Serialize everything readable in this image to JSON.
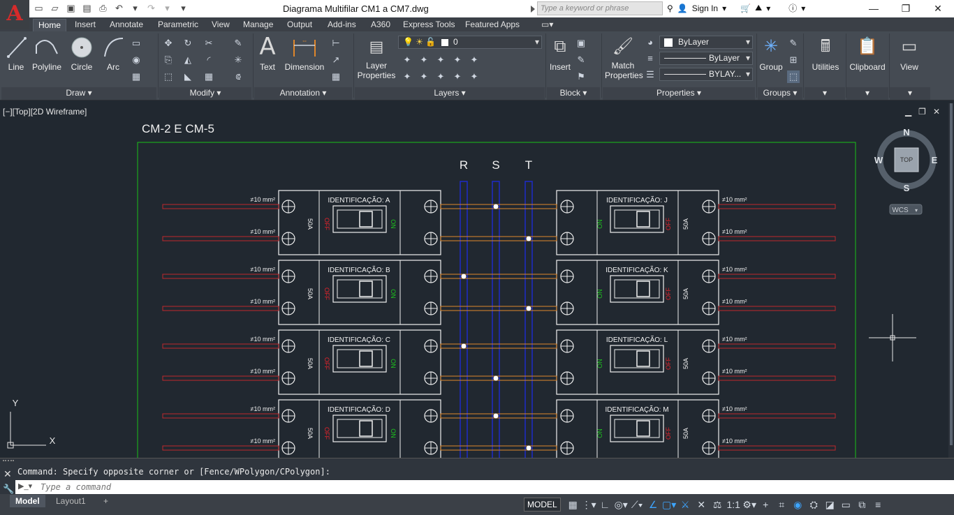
{
  "app": {
    "logo": "A",
    "title": "Diagrama Multifilar CM1 a CM7.dwg"
  },
  "search": {
    "placeholder": "Type a keyword or phrase"
  },
  "account": {
    "sign_in": "Sign In"
  },
  "tabs": [
    "Home",
    "Insert",
    "Annotate",
    "Parametric",
    "View",
    "Manage",
    "Output",
    "Add-ins",
    "A360",
    "Express Tools",
    "Featured Apps"
  ],
  "ribbon": {
    "draw": {
      "line": "Line",
      "polyline": "Polyline",
      "circle": "Circle",
      "arc": "Arc",
      "panel": "Draw ▾"
    },
    "modify": {
      "panel": "Modify ▾"
    },
    "annotation": {
      "text": "Text",
      "dimension": "Dimension",
      "panel": "Annotation ▾"
    },
    "layers": {
      "layer_properties_1": "Layer",
      "layer_properties_2": "Properties",
      "current_layer": "0",
      "panel": "Layers ▾"
    },
    "block": {
      "insert": "Insert",
      "panel": "Block ▾"
    },
    "properties": {
      "match_1": "Match",
      "match_2": "Properties",
      "color": "ByLayer",
      "linetype": "ByLayer",
      "lineweight": "BYLAY...",
      "panel": "Properties ▾"
    },
    "groups": {
      "group": "Group",
      "panel": "Groups ▾"
    },
    "utilities": "Utilities",
    "clipboard": "Clipboard",
    "view": "View"
  },
  "viewport": {
    "label": "[−][Top][2D Wireframe]",
    "compass": {
      "n": "N",
      "s": "S",
      "e": "E",
      "w": "W",
      "top": "TOP",
      "wcs": "WCS"
    },
    "ucs": {
      "x": "X",
      "y": "Y"
    }
  },
  "drawing": {
    "title": "CM-2 E CM-5",
    "phases": [
      "R",
      "S",
      "T"
    ],
    "left_ids": [
      "IDENTIFICAÇÃO: A",
      "IDENTIFICAÇÃO: B",
      "IDENTIFICAÇÃO: C",
      "IDENTIFICAÇÃO: D"
    ],
    "right_ids": [
      "IDENTIFICAÇÃO: J",
      "IDENTIFICAÇÃO: K",
      "IDENTIFICAÇÃO: L",
      "IDENTIFICAÇÃO: M"
    ],
    "cable": "≠10 mm²",
    "rating": "50A",
    "off": "OFF",
    "on": "ON",
    "left_dots": [
      [
        "S",
        "T"
      ],
      [
        "R",
        "T"
      ],
      [
        "R",
        "S"
      ],
      [
        "S",
        "T"
      ]
    ],
    "right_dots": [
      [
        "S",
        "T"
      ],
      [
        "R",
        "T"
      ],
      [
        "R",
        "S"
      ],
      [
        "S",
        "T"
      ]
    ],
    "colors": {
      "border": "#19c019",
      "cable": "#c0272d",
      "bus": "#1e2bc8",
      "link": "#e0872b",
      "off": "#e0242b",
      "on": "#1ec21e"
    }
  },
  "command": {
    "history": "Command: Specify opposite corner or [Fence/WPolygon/CPolygon]:",
    "placeholder": "Type a command"
  },
  "status": {
    "tabs": [
      "Model",
      "Layout1"
    ],
    "add": "+",
    "model": "MODEL",
    "scale": "1:1"
  }
}
